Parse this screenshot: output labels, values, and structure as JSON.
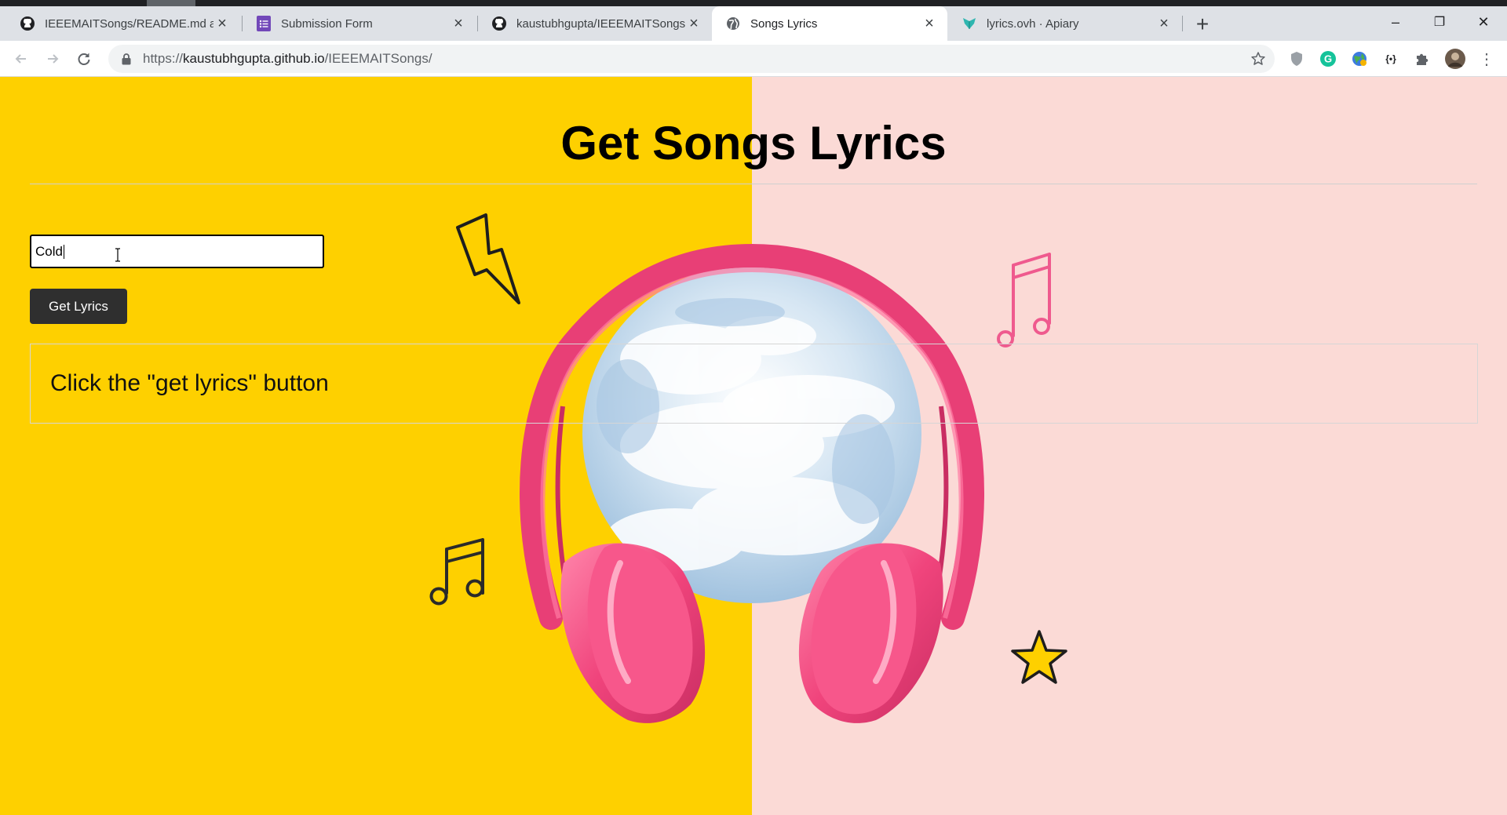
{
  "browser": {
    "tabs": [
      {
        "title": "IEEEMAITSongs/README.md at m",
        "icon": "github-icon",
        "active": false
      },
      {
        "title": "Submission Form",
        "icon": "google-forms-icon",
        "active": false
      },
      {
        "title": "kaustubhgupta/IEEEMAITSongs",
        "icon": "github-icon",
        "active": false
      },
      {
        "title": "Songs Lyrics",
        "icon": "globe-icon",
        "active": true
      },
      {
        "title": "lyrics.ovh · Apiary",
        "icon": "apiary-icon",
        "active": false
      }
    ],
    "new_tab_label": "+",
    "window_controls": {
      "minimize": "–",
      "restore": "❐",
      "close": "✕"
    },
    "url_scheme": "https://",
    "url_host": "kaustubhgupta.github.io",
    "url_path": "/IEEEMAITSongs/",
    "extensions": [
      "shield-icon",
      "grammarly-icon",
      "globe-extension-icon",
      "json-viewer-icon",
      "puzzle-icon",
      "profile-avatar"
    ]
  },
  "page": {
    "title": "Get Songs Lyrics",
    "search": {
      "value": "Cold",
      "placeholder": ""
    },
    "button_label": "Get Lyrics",
    "result_text": "Click the \"get lyrics\" button"
  },
  "colors": {
    "left_background": "#fed000",
    "right_background": "#fbdad6",
    "headphones_pink": "#f0447c",
    "button_dark": "#2f2f2f",
    "note_pink": "#ef5a8e"
  }
}
